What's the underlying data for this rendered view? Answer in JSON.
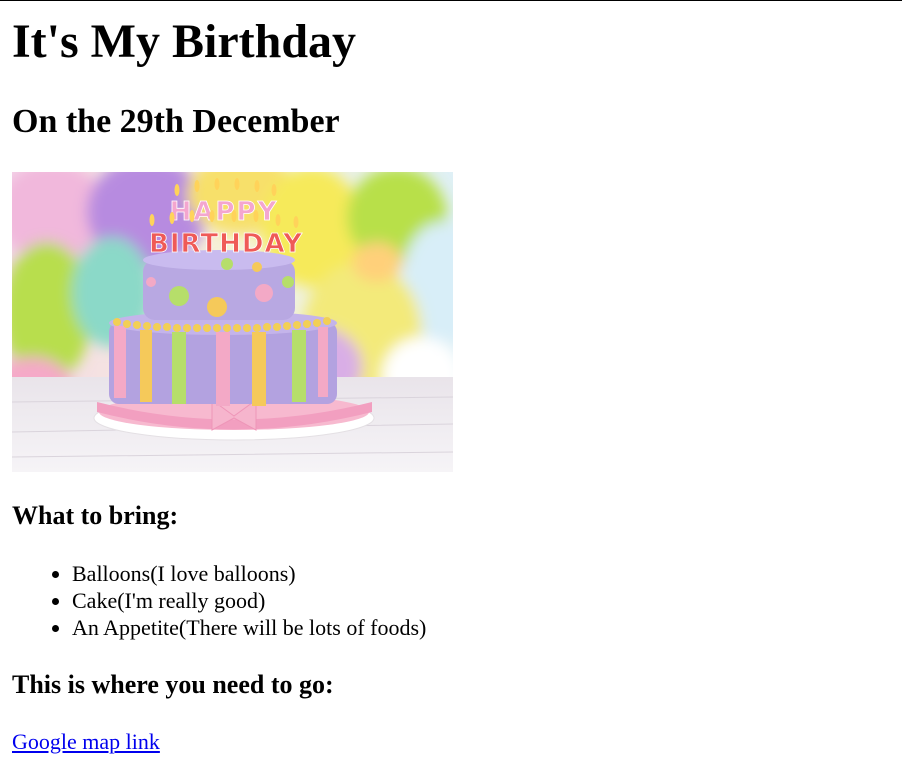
{
  "page": {
    "title": "It's My Birthday",
    "subtitle": "On the 29th December"
  },
  "image": {
    "alt": "Birthday cake with HAPPY BIRTHDAY candles",
    "candle_line1": "HAPPY",
    "candle_line2": "BIRTHDAY"
  },
  "bring": {
    "heading": "What to bring:",
    "items": [
      "Balloons(I love balloons)",
      "Cake(I'm really good)",
      "An Appetite(There will be lots of foods)"
    ]
  },
  "directions": {
    "heading": "This is where you need to go:",
    "link_label": "Google map link"
  },
  "colors": {
    "link": "#0000ee",
    "text": "#000000",
    "background": "#ffffff"
  }
}
